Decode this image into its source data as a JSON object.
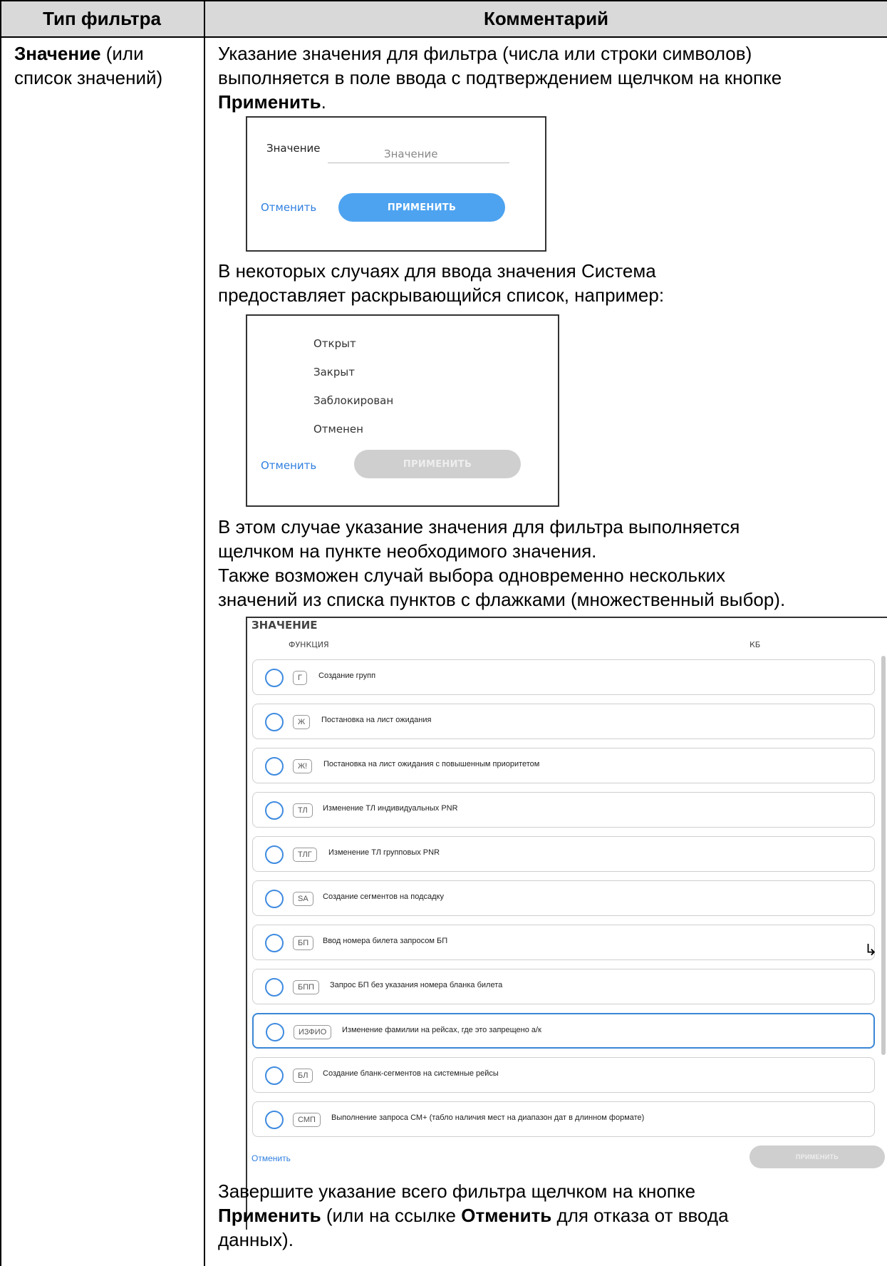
{
  "header": {
    "col1": "Тип фильтра",
    "col2": "Комментарий"
  },
  "left_cell": {
    "bold": "Значение",
    "rest1": " (или",
    "line2": "список значений)"
  },
  "para1": {
    "line1": "Указание значения для фильтра (числа или строки символов)",
    "line2": "выполняется в поле ввода с подтверждением щелчком на кнопке",
    "line3_bold": "Применить",
    "line3_rest": "."
  },
  "shot1": {
    "label": "Значение",
    "placeholder": "Значение",
    "cancel": "Отменить",
    "apply": "ПРИМЕНИТЬ"
  },
  "para2": {
    "line1": "В некоторых случаях для ввода значения Система",
    "line2": "предоставляет раскрывающийся список, например:"
  },
  "shot2": {
    "options": [
      "Открыт",
      "Закрыт",
      "Заблокирован",
      "Отменен"
    ],
    "cancel": "Отменить",
    "apply": "ПРИМЕНИТЬ"
  },
  "para3": {
    "line1": "В этом случае указание значения для фильтра выполняется",
    "line2": "щелчком на пункте необходимого значения.",
    "line3": "Также возможен случай выбора одновременно нескольких",
    "line4": "значений из списка пунктов с флажками (множественный выбор)."
  },
  "shot3": {
    "title": "ЗНАЧЕНИЕ",
    "col_function": "ФУНКЦИЯ",
    "col_kb": "КБ",
    "rows": [
      {
        "code": "Г",
        "text": "Создание групп"
      },
      {
        "code": "Ж",
        "text": "Постановка на лист ожидания"
      },
      {
        "code": "Ж!",
        "text": "Постановка на лист ожидания с повышенным приоритетом"
      },
      {
        "code": "ТЛ",
        "text": "Изменение ТЛ индивидуальных PNR"
      },
      {
        "code": "ТЛГ",
        "text": "Изменение ТЛ групповых PNR"
      },
      {
        "code": "SA",
        "text": "Создание сегментов на подсадку"
      },
      {
        "code": "БП",
        "text": "Ввод номера билета запросом БП"
      },
      {
        "code": "БПП",
        "text": "Запрос БП без указания номера бланка билета"
      },
      {
        "code": "ИЗФИО",
        "text": "Изменение фамилии на рейсах, где это запрещено а/к"
      },
      {
        "code": "БЛ",
        "text": "Создание бланк-сегментов на системные рейсы"
      },
      {
        "code": "СМП",
        "text": "Выполнение запроса СМ+ (табло наличия мест на диапазон дат в длинном формате)"
      }
    ],
    "cancel": "Отменить",
    "apply": "ПРИМЕНИТЬ"
  },
  "para4": {
    "line1": "Завершите указание всего фильтра щелчком на кнопке",
    "line2_bold1": "Применить",
    "line2_mid": " (или на ссылке ",
    "line2_bold2": "Отменить",
    "line2_end": " для отказа от ввода",
    "line3": "данных)."
  },
  "colors": {
    "header_bg": "#d9d9d9",
    "link": "#2f7fe0",
    "apply_blue": "#4da3f0",
    "apply_gray": "#cfcfcf",
    "radio": "#3f8be0"
  }
}
